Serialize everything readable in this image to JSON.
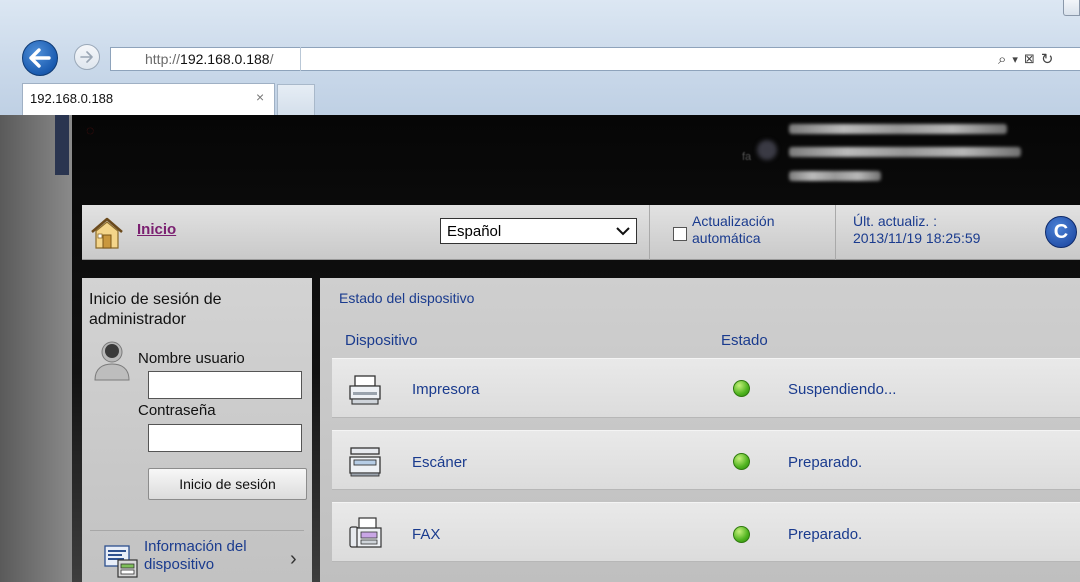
{
  "browser": {
    "address_scheme": "http://",
    "address_host": "192.168.0.188",
    "address_path": "/",
    "tab_title": "192.168.0.188",
    "tab_close": "×",
    "search_glyph": "⌕",
    "dropdown_glyph": "▾",
    "compat_glyph": "⊠",
    "refresh_glyph": "↻"
  },
  "nav": {
    "home_label": "Inicio",
    "language_value": "Español",
    "auto_update_line1": "Actualización",
    "auto_update_line2": "automática",
    "last_update_line1": "Últ. actualiz. :",
    "last_update_line2": "2013/11/19 18:25:59",
    "refresh_letter": "C"
  },
  "login": {
    "title_line1": "Inicio de sesión de",
    "title_line2": "administrador",
    "username_label": "Nombre usuario",
    "username_value": "",
    "password_label": "Contraseña",
    "password_value": "",
    "button_label": "Inicio de sesión",
    "device_info_line1": "Información del",
    "device_info_line2": "dispositivo",
    "chevron": "›"
  },
  "status": {
    "title": "Estado del dispositivo",
    "col_device": "Dispositivo",
    "col_state": "Estado",
    "rows": [
      {
        "name": "Impresora",
        "state": "Suspendiendo...",
        "indicator_color": "#4fb31f",
        "icon": "printer-icon"
      },
      {
        "name": "Escáner",
        "state": "Preparado.",
        "indicator_color": "#4fb31f",
        "icon": "scanner-icon"
      },
      {
        "name": "FAX",
        "state": "Preparado.",
        "indicator_color": "#4fb31f",
        "icon": "fax-icon"
      }
    ]
  },
  "colors": {
    "link_purple": "#7a1f70",
    "text_blue": "#1a3b8e",
    "status_green": "#4fb31f"
  }
}
